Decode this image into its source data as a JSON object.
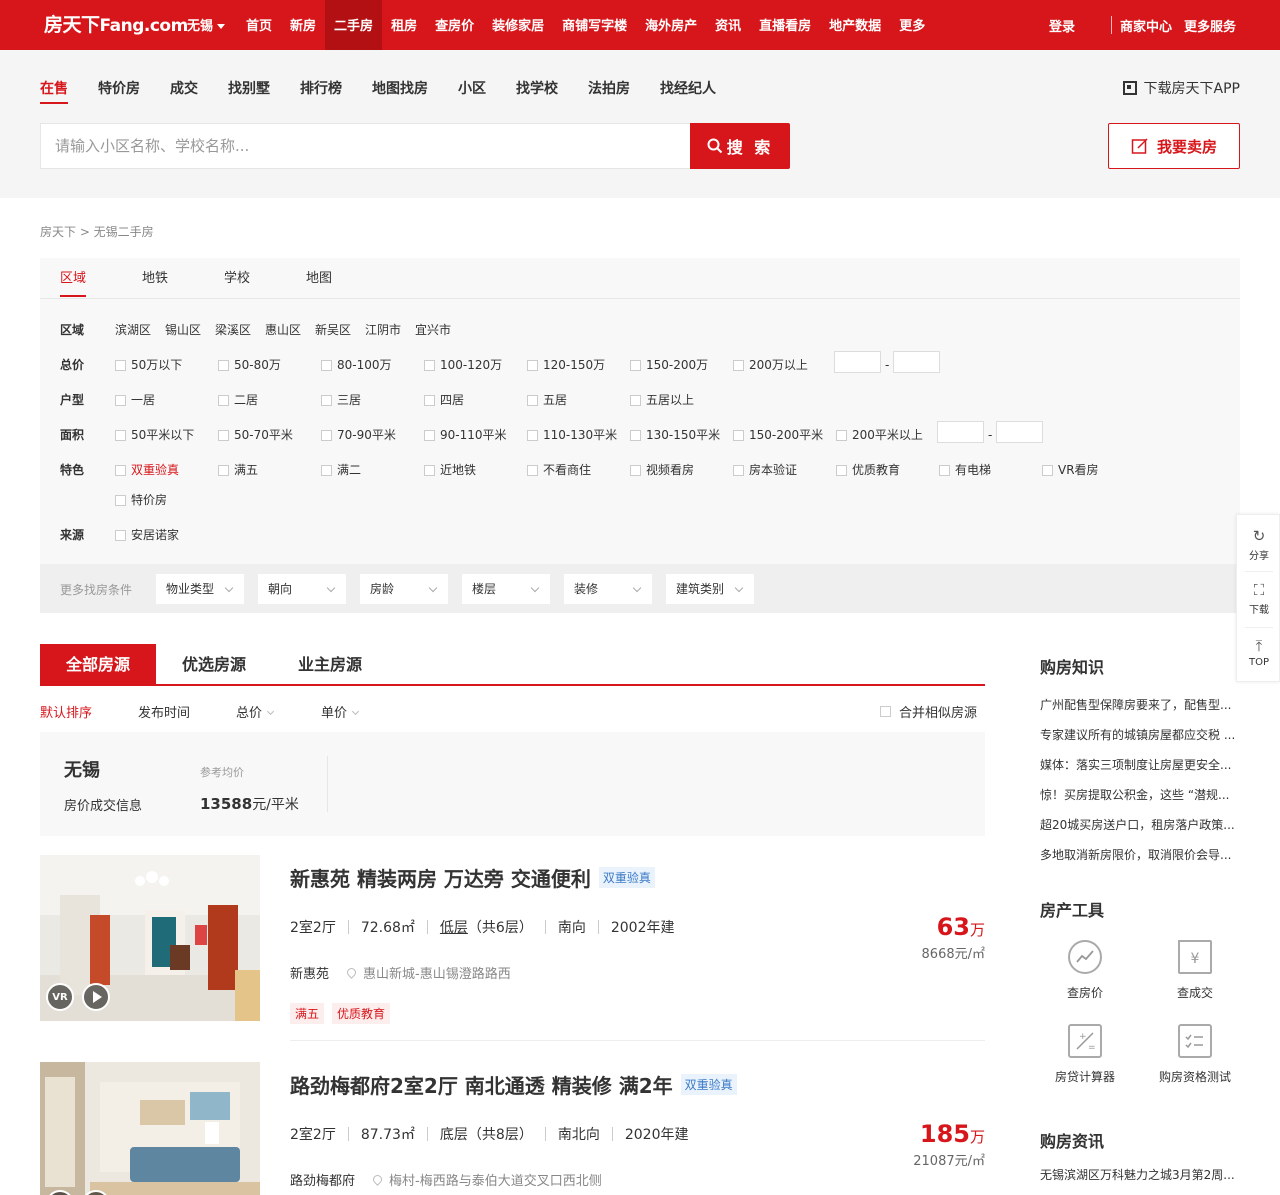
{
  "header": {
    "logo_cn": "房天下",
    "logo_en": "Fang.com",
    "city": "无锡",
    "nav": [
      "首页",
      "新房",
      "二手房",
      "租房",
      "查房价",
      "装修家居",
      "商铺写字楼",
      "海外房产",
      "资讯",
      "直播看房",
      "地产数据",
      "更多"
    ],
    "active_nav": "二手房",
    "login": "登录",
    "merchant": "商家中心",
    "more_services": "更多服务"
  },
  "subnav": {
    "items": [
      "在售",
      "特价房",
      "成交",
      "找别墅",
      "排行榜",
      "地图找房",
      "小区",
      "找学校",
      "法拍房",
      "找经纪人"
    ],
    "active": "在售",
    "app_download": "下载房天下APP"
  },
  "search": {
    "placeholder": "请输入小区名称、学校名称...",
    "button": "搜 索",
    "sell_button": "我要卖房"
  },
  "breadcrumb": "房天下 > 无锡二手房",
  "filter": {
    "tabs": [
      "区域",
      "地铁",
      "学校",
      "地图"
    ],
    "region": {
      "label": "区域",
      "options": [
        "滨湖区",
        "锡山区",
        "梁溪区",
        "惠山区",
        "新吴区",
        "江阴市",
        "宜兴市"
      ]
    },
    "price": {
      "label": "总价",
      "options": [
        "50万以下",
        "50-80万",
        "80-100万",
        "100-120万",
        "120-150万",
        "150-200万",
        "200万以上"
      ]
    },
    "layout": {
      "label": "户型",
      "options": [
        "一居",
        "二居",
        "三居",
        "四居",
        "五居",
        "五居以上"
      ]
    },
    "area": {
      "label": "面积",
      "options": [
        "50平米以下",
        "50-70平米",
        "70-90平米",
        "90-110平米",
        "110-130平米",
        "130-150平米",
        "150-200平米",
        "200平米以上"
      ]
    },
    "feature": {
      "label": "特色",
      "options": [
        "双重验真",
        "满五",
        "满二",
        "近地铁",
        "不看商住",
        "视频看房",
        "房本验证",
        "优质教育",
        "有电梯",
        "VR看房",
        "特价房"
      ]
    },
    "source": {
      "label": "来源",
      "options": [
        "安居诺家"
      ]
    },
    "more_label": "更多找房条件",
    "more": [
      "物业类型",
      "朝向",
      "房龄",
      "楼层",
      "装修",
      "建筑类别"
    ]
  },
  "list": {
    "tabs": [
      "全部房源",
      "优选房源",
      "业主房源"
    ],
    "sorts": [
      "默认排序",
      "发布时间",
      "总价",
      "单价"
    ],
    "merge": "合并相似房源",
    "city_box": {
      "city": "无锡",
      "info": "房价成交信息",
      "ref_label": "参考均价",
      "avg": "13588",
      "avg_unit": "元/平米"
    },
    "items": [
      {
        "title": "新惠苑 精装两房 万达旁 交通便利",
        "verify": "双重验真",
        "rooms": "2室2厅",
        "area": "72.68㎡",
        "floor": "低层",
        "floors_total": "（共6层）",
        "orient": "南向",
        "year": "2002年建",
        "community": "新惠苑",
        "address": "惠山新城-惠山锡澄路路西",
        "tags": [
          "满五",
          "优质教育"
        ],
        "price": "63",
        "price_unit": "万",
        "unit_price": "8668元/㎡"
      },
      {
        "title": "路劲梅都府2室2厅 南北通透 精装修 满2年",
        "verify": "双重验真",
        "rooms": "2室2厅",
        "area": "87.73㎡",
        "floor": "底层",
        "floors_total": "（共8层）",
        "orient": "南北向",
        "year": "2020年建",
        "community": "路劲梅都府",
        "address": "梅村-梅西路与泰伯大道交叉口西北侧",
        "tags": [],
        "price": "185",
        "price_unit": "万",
        "unit_price": "21087元/㎡"
      }
    ],
    "vr": "VR"
  },
  "side": {
    "knowledge_title": "购房知识",
    "knowledge": [
      "广州配售型保障房要来了，配售型...",
      "专家建议所有的城镇房屋都应交税 ...",
      "媒体：落实三项制度让房屋更安全...",
      "惊！买房提取公积金，这些 “潜规...",
      "超20城买房送户口，租房落户政策...",
      "多地取消新房限价，取消限价会导..."
    ],
    "tools_title": "房产工具",
    "tools": [
      "查房价",
      "查成交",
      "房贷计算器",
      "购房资格测试"
    ],
    "news_title": "购房资讯",
    "news": [
      "无锡滨湖区万科魅力之城3月第2周..."
    ]
  },
  "floatbar": {
    "share": "分享",
    "download": "下载",
    "top": "TOP"
  },
  "colors": {
    "brand_red": "#d7161b"
  }
}
